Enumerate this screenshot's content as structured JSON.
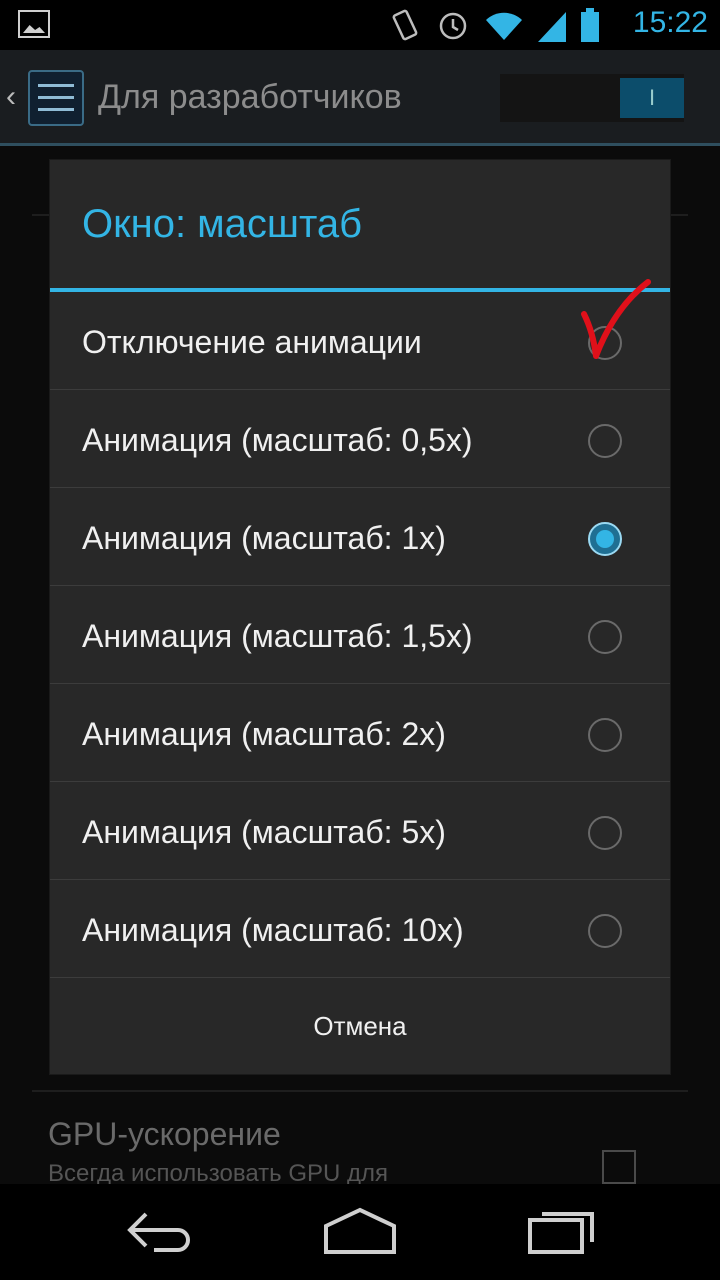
{
  "status_bar": {
    "time": "15:22"
  },
  "action_bar": {
    "title": "Для разработчиков",
    "switch_text": "I"
  },
  "dialog": {
    "title": "Окно: масштаб",
    "options": [
      {
        "label": "Отключение анимации",
        "checked": false
      },
      {
        "label": "Анимация (масштаб: 0,5x)",
        "checked": false
      },
      {
        "label": "Анимация (масштаб: 1x)",
        "checked": true
      },
      {
        "label": "Анимация (масштаб: 1,5x)",
        "checked": false
      },
      {
        "label": "Анимация (масштаб: 2x)",
        "checked": false
      },
      {
        "label": "Анимация (масштаб: 5x)",
        "checked": false
      },
      {
        "label": "Анимация (масштаб: 10x)",
        "checked": false
      }
    ],
    "cancel_label": "Отмена"
  },
  "background": {
    "gpu_title": "GPU-ускорение",
    "gpu_subtitle": "Всегда использовать GPU для"
  },
  "colors": {
    "accent": "#33b5e5",
    "annotation": "#e0101a"
  }
}
